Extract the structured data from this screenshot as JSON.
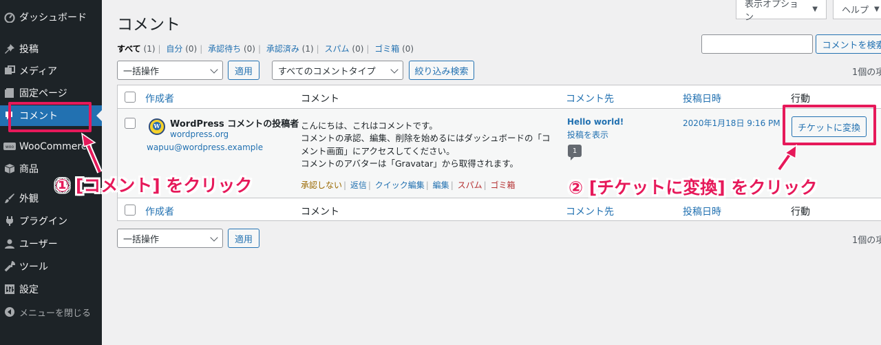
{
  "sidebar": {
    "items": [
      {
        "label": "ダッシュボード",
        "icon": "dashboard-icon"
      },
      {
        "label": "投稿",
        "icon": "pin-icon"
      },
      {
        "label": "メディア",
        "icon": "media-icon"
      },
      {
        "label": "固定ページ",
        "icon": "page-icon"
      },
      {
        "label": "コメント",
        "icon": "comment-icon"
      },
      {
        "label": "WooCommerce",
        "icon": "woo-icon"
      },
      {
        "label": "商品",
        "icon": "box-icon"
      },
      {
        "label": "外観",
        "icon": "brush-icon"
      },
      {
        "label": "プラグイン",
        "icon": "plug-icon"
      },
      {
        "label": "ユーザー",
        "icon": "user-icon"
      },
      {
        "label": "ツール",
        "icon": "wrench-icon"
      },
      {
        "label": "設定",
        "icon": "settings-icon"
      }
    ],
    "collapse_label": "メニューを閉じる"
  },
  "screen_meta": {
    "options_label": "表示オプション",
    "help_label": "ヘルプ"
  },
  "page_title": "コメント",
  "filters": [
    {
      "label": "すべて",
      "count": "(1)"
    },
    {
      "label": "自分",
      "count": "(0)"
    },
    {
      "label": "承認待ち",
      "count": "(0)"
    },
    {
      "label": "承認済み",
      "count": "(1)"
    },
    {
      "label": "スパム",
      "count": "(0)"
    },
    {
      "label": "ゴミ箱",
      "count": "(0)"
    }
  ],
  "search": {
    "button_label": "コメントを検索",
    "value": ""
  },
  "bulk": {
    "selected": "一括操作",
    "apply_label": "適用"
  },
  "type_filter": {
    "selected": "すべてのコメントタイプ",
    "button_label": "絞り込み検索"
  },
  "items_count": "1個の項",
  "table": {
    "headers": [
      "作成者",
      "コメント",
      "コメント先",
      "投稿日時",
      "行動"
    ],
    "row": {
      "author_name": "WordPress コメントの投稿者",
      "author_url": "wordpress.org",
      "author_email": "wapuu@wordpress.example",
      "comment_lines": [
        "こんにちは、これはコメントです。",
        "コメントの承認、編集、削除を始めるにはダッシュボードの「コ",
        "メント画面」にアクセスしてください。",
        "コメントのアバターは「Gravatar」から取得されます。"
      ],
      "actions": {
        "unapprove": "承認しない",
        "reply": "返信",
        "quick_edit": "クイック編集",
        "edit": "編集",
        "spam": "スパム",
        "trash": "ゴミ箱"
      },
      "response_title": "Hello world!",
      "response_view": "投稿を表示",
      "response_count": "1",
      "date": "2020年1月18日 9:16 PM",
      "ticket_button": "チケットに変換"
    }
  },
  "annotations": {
    "step1": "① [コメント] をクリック",
    "step2": "② [チケットに変換] をクリック"
  },
  "colors": {
    "sidebar_bg": "#1d2327",
    "active": "#2271b1",
    "highlight": "#e6195a"
  }
}
